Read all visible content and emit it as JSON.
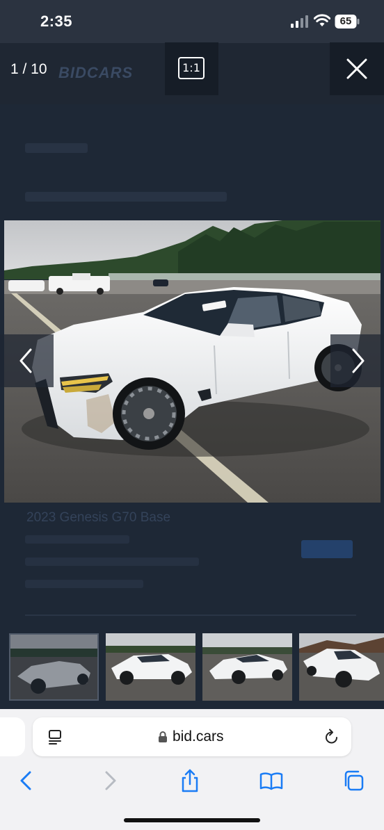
{
  "status_bar": {
    "time": "2:35",
    "battery_level": "65"
  },
  "viewer": {
    "counter": "1 / 10",
    "ratio_label": "1:1",
    "background_logo": "BIDCARS"
  },
  "background_page": {
    "listing_title": "2023 Genesis G70 Base"
  },
  "thumbnails": [
    {
      "label": "thumbnail-1",
      "selected": true
    },
    {
      "label": "thumbnail-2",
      "selected": false
    },
    {
      "label": "thumbnail-3",
      "selected": false
    },
    {
      "label": "thumbnail-4",
      "selected": false
    }
  ],
  "browser": {
    "url": "bid.cars",
    "icons": [
      "reader-icon",
      "lock-icon",
      "reload-icon",
      "back-icon",
      "forward-icon",
      "share-icon",
      "bookmarks-icon",
      "tabs-icon"
    ]
  },
  "colors": {
    "accent": "#1a7cf5",
    "overlay": "#1b2330"
  }
}
